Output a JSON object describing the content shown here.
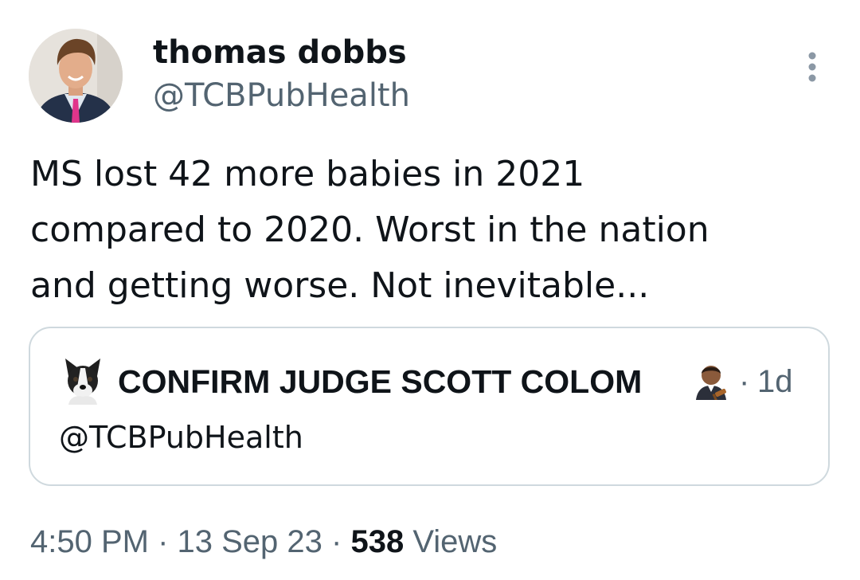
{
  "author": {
    "display_name": "thomas dobbs",
    "handle": "@TCBPubHealth",
    "avatar_icon": "profile-photo"
  },
  "more_icon": "more-vertical-icon",
  "tweet": {
    "text_lines": [
      "MS lost 42 more babies in 2021",
      "compared to 2020. Worst in the nation",
      "and getting worse. Not inevitable..."
    ]
  },
  "quoted": {
    "display_name": "CONFIRM JUDGE SCOTT COLOM",
    "handle": "@TCBPubHealth",
    "separator": "·",
    "time": "1d",
    "avatar_icon": "boston-terrier-dog",
    "badge_icon": "judge-emoji"
  },
  "meta": {
    "time": "4:50 PM",
    "sep1": " · ",
    "date": "13 Sep 23",
    "sep2": " · ",
    "views_count": "538",
    "views_label": " Views"
  },
  "colors": {
    "primary_text": "#0f1419",
    "secondary_text": "#536471",
    "border": "#cfd9de"
  }
}
